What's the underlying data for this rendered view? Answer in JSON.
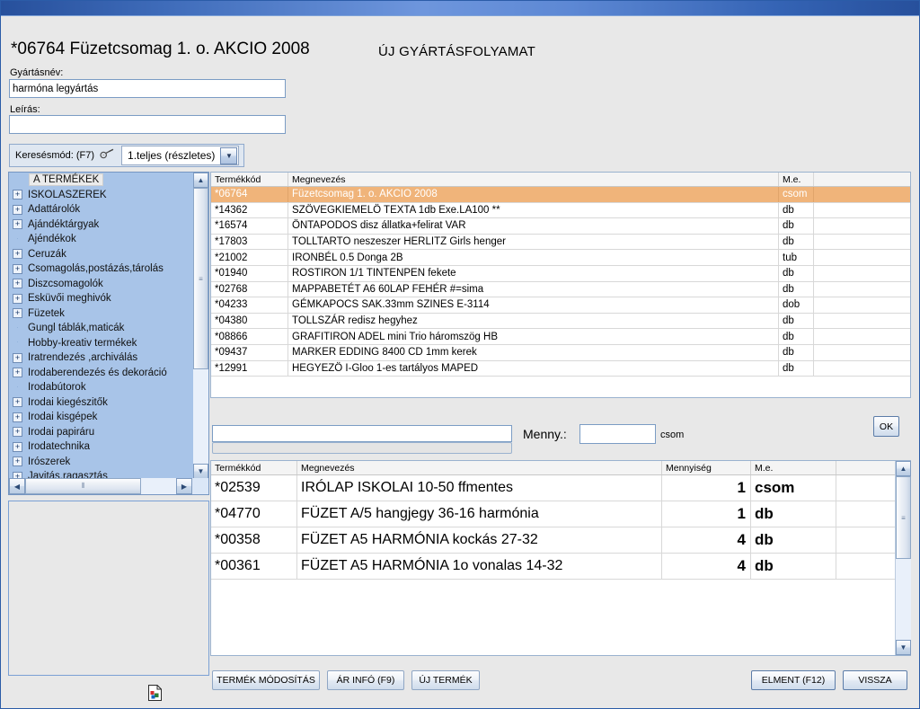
{
  "window": {
    "document_title": "*06764 Füzetcsomag  1. o.   AKCIO 2008",
    "screen_title": "ÚJ GYÁRTÁSFOLYAMAT"
  },
  "form": {
    "name_label": "Gyártásnév:",
    "name_value": "harmóna legyártás",
    "desc_label": "Leírás:",
    "desc_value": ""
  },
  "search_mode": {
    "label": "Keresésmód: (F7)",
    "selected": "1.teljes (részletes)",
    "icon": "key-icon",
    "arrow": "chevron-down-icon"
  },
  "tree": {
    "items": [
      {
        "label": "A TERMÉKEK",
        "expandable": false,
        "root": true
      },
      {
        "label": "ISKOLASZEREK",
        "expandable": true
      },
      {
        "label": "Adattárolók",
        "expandable": true
      },
      {
        "label": "Ajándéktárgyak",
        "expandable": true
      },
      {
        "label": "Ajéndékok",
        "expandable": false
      },
      {
        "label": "Ceruzák",
        "expandable": true
      },
      {
        "label": "Csomagolás,postázás,tárolás",
        "expandable": true
      },
      {
        "label": "Diszcsomagolók",
        "expandable": true
      },
      {
        "label": "Esküvői meghivók",
        "expandable": true
      },
      {
        "label": "Füzetek",
        "expandable": true
      },
      {
        "label": "Gungl táblák,maticák",
        "expandable": false
      },
      {
        "label": "Hobby-kreativ termékek",
        "expandable": false
      },
      {
        "label": "Iratrendezés ,archiválás",
        "expandable": true
      },
      {
        "label": "Irodaberendezés és dekoráció",
        "expandable": true
      },
      {
        "label": "Irodabútorok",
        "expandable": false
      },
      {
        "label": "Irodai kiegészitők",
        "expandable": true
      },
      {
        "label": "Irodai kisgépek",
        "expandable": true
      },
      {
        "label": "Irodai papiráru",
        "expandable": true
      },
      {
        "label": "Irodatechnika",
        "expandable": true
      },
      {
        "label": "Irószerek",
        "expandable": true
      },
      {
        "label": "Javitás,ragasztás",
        "expandable": true
      }
    ]
  },
  "product_grid": {
    "columns": [
      "Termékkód",
      "Megnevezés",
      "M.e."
    ],
    "rows": [
      {
        "code": "*06764",
        "name": "Füzetcsomag  1. o.   AKCIO 2008",
        "unit": "csom",
        "selected": true
      },
      {
        "code": "*14362",
        "name": "SZÖVEGKIEMELÖ TEXTA 1db Exe.LA100 **",
        "unit": "db",
        "selected": false
      },
      {
        "code": "*16574",
        "name": "ÖNTAPODOS disz állatka+felirat   VAR",
        "unit": "db",
        "selected": false
      },
      {
        "code": "*17803",
        "name": "TOLLTARTO neszeszer HERLITZ Girls henger",
        "unit": "db",
        "selected": false
      },
      {
        "code": "*21002",
        "name": "IRONBÉL 0.5 Donga    2B",
        "unit": "tub",
        "selected": false
      },
      {
        "code": "*01940",
        "name": "ROSTIRON 1/1 TINTENPEN      fekete",
        "unit": "db",
        "selected": false
      },
      {
        "code": "*02768",
        "name": "MAPPABETÉT A6 60LAP FEHÉR #=sima",
        "unit": "db",
        "selected": false
      },
      {
        "code": "*04233",
        "name": "GÉMKAPOCS SAK.33mm SZINES    E-3114",
        "unit": "dob",
        "selected": false
      },
      {
        "code": "*04380",
        "name": "TOLLSZÁR  redisz hegyhez",
        "unit": "db",
        "selected": false
      },
      {
        "code": "*08866",
        "name": "GRAFITIRON ADEL mini Trio  háromszög HB",
        "unit": "db",
        "selected": false
      },
      {
        "code": "*09437",
        "name": "MARKER EDDING 8400 CD  1mm   kerek",
        "unit": "db",
        "selected": false
      },
      {
        "code": "*12991",
        "name": "HEGYEZÖ I-Gloo  1-es tartályos    MAPED",
        "unit": "db",
        "selected": false
      }
    ]
  },
  "entry_bar": {
    "search_value": "",
    "qty_label": "Menny.:",
    "qty_value": "",
    "qty_unit": "csom",
    "ok_label": "OK"
  },
  "selection_grid": {
    "columns": [
      "Termékkód",
      "Megnevezés",
      "Mennyiség",
      "M.e."
    ],
    "rows": [
      {
        "code": "*02539",
        "name": "IRÓLAP ISKOLAI 10-50 ffmentes",
        "qty": "1",
        "unit": "csom"
      },
      {
        "code": "*04770",
        "name": "FÜZET A/5  hangjegy   36-16  harmónia",
        "qty": "1",
        "unit": "db"
      },
      {
        "code": "*00358",
        "name": "FÜZET A5  HARMÓNIA    kockás    27-32",
        "qty": "4",
        "unit": "db"
      },
      {
        "code": "*00361",
        "name": "FÜZET A5  HARMÓNIA  1o vonalas  14-32",
        "qty": "4",
        "unit": "db"
      }
    ]
  },
  "footer": {
    "modify_product": "TERMÉK MÓDOSÍTÁS",
    "price_info": "ÁR INFÓ (F9)",
    "new_product": "ÚJ TERMÉK",
    "save": "ELMENT (F12)",
    "back": "VISSZA"
  },
  "colors": {
    "selection_highlight": "#f0b47a",
    "titlebar_blue": "#3f6cba",
    "tree_background": "#a8c4e8"
  }
}
